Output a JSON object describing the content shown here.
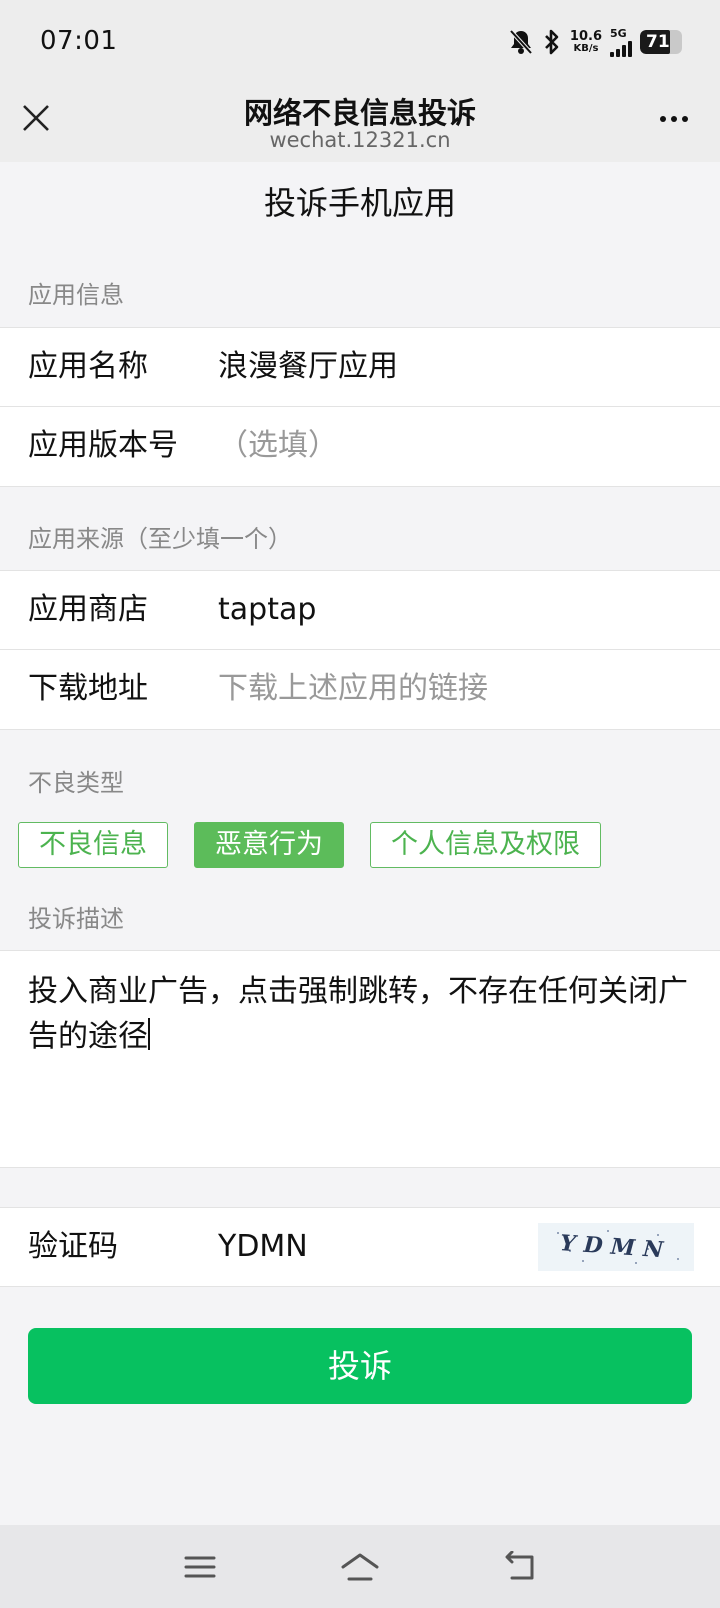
{
  "status_bar": {
    "time": "07:01",
    "net_speed_value": "10.6",
    "net_speed_unit": "KB/s",
    "network": "5G",
    "battery_level": "71",
    "battery_fraction": 0.71,
    "icons": [
      "mute-bell-icon",
      "bluetooth-icon",
      "signal-icon",
      "battery-icon"
    ]
  },
  "header": {
    "title": "网络不良信息投诉",
    "url": "wechat.12321.cn",
    "close_icon": "close-icon",
    "more_icon": "more-icon"
  },
  "page_title": "投诉手机应用",
  "app_info": {
    "section_label": "应用信息",
    "name_label": "应用名称",
    "name_value": "浪漫餐厅应用",
    "version_label": "应用版本号",
    "version_placeholder": "（选填）"
  },
  "app_source": {
    "section_label": "应用来源（至少填一个）",
    "store_label": "应用商店",
    "store_value": "taptap",
    "download_label": "下载地址",
    "download_placeholder": "下载上述应用的链接"
  },
  "bad_type": {
    "section_label": "不良类型",
    "tags": [
      {
        "label": "不良信息",
        "selected": false
      },
      {
        "label": "恶意行为",
        "selected": true
      },
      {
        "label": "个人信息及权限",
        "selected": false
      }
    ]
  },
  "description": {
    "section_label": "投诉描述",
    "value": "投入商业广告，点击强制跳转，不存在任何关闭广告的途径"
  },
  "captcha": {
    "label": "验证码",
    "value": "YDMN",
    "image_text": "YDMN"
  },
  "submit_label": "投诉",
  "colors": {
    "accent_green": "#07c160",
    "tag_green": "#5cbc5a",
    "background": "#f4f4f6"
  },
  "bottom_nav": [
    "menu-icon",
    "home-icon",
    "back-icon"
  ]
}
